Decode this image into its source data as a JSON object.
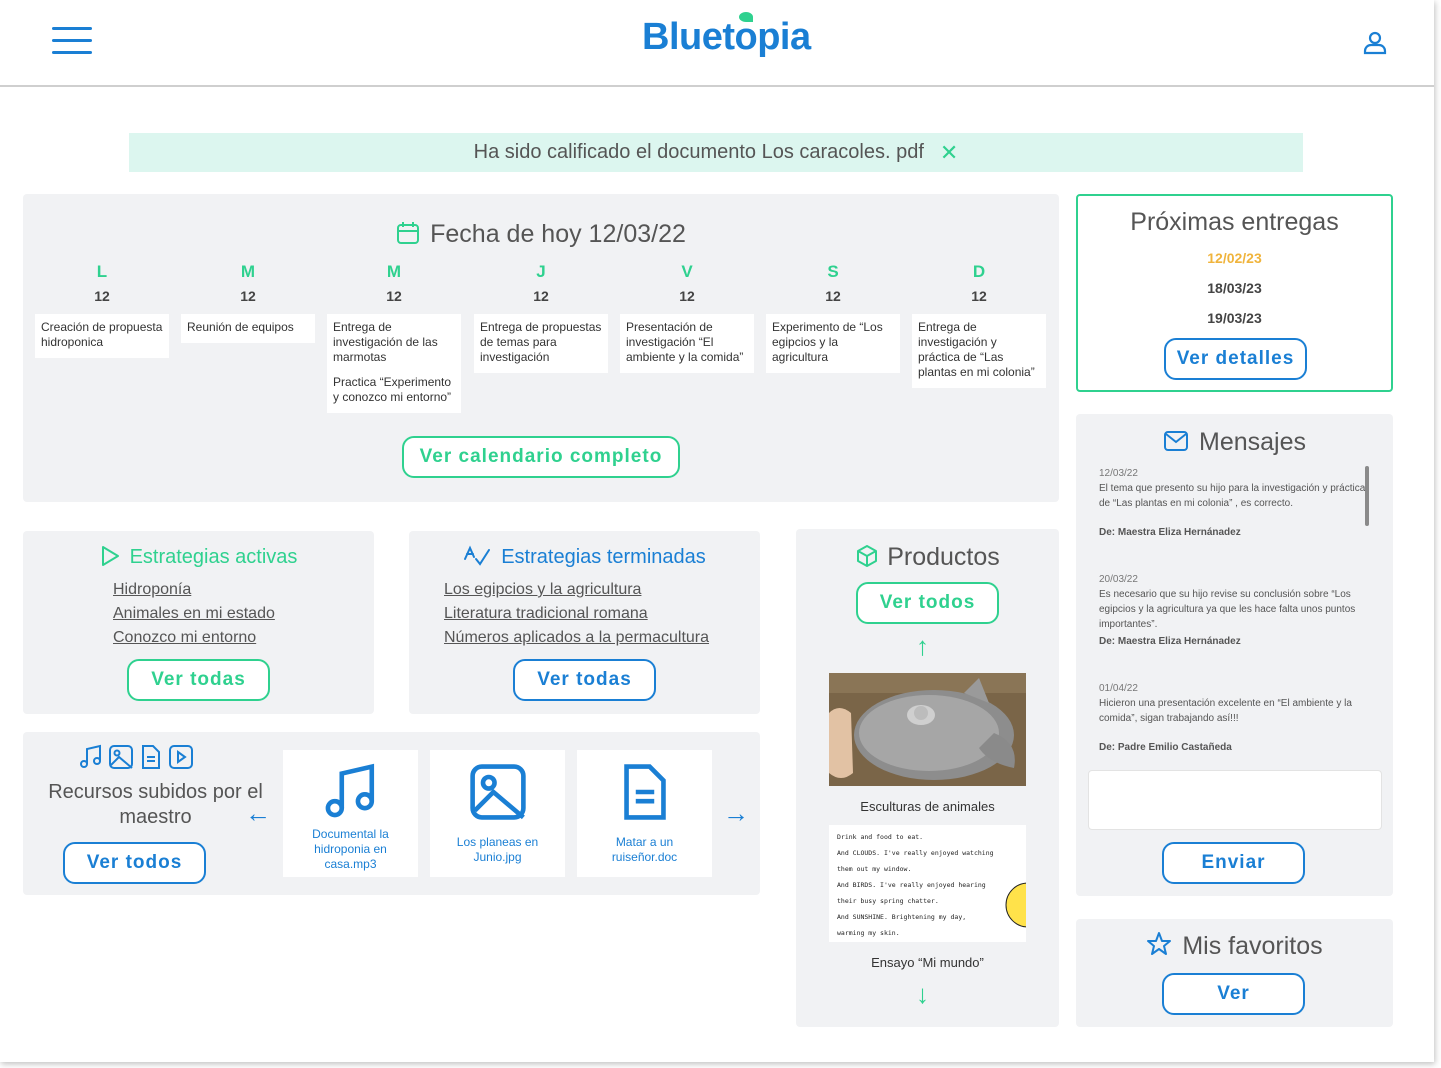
{
  "header": {
    "logo_text": "Bluetopia",
    "logo_prefix": "Bluet",
    "logo_o": "o",
    "logo_suffix": "pia"
  },
  "notice": {
    "text": "Ha sido calificado el documento Los caracoles. pdf",
    "close": "✕"
  },
  "calendar": {
    "title": "Fecha de hoy 12/03/22",
    "days": [
      {
        "letter": "L",
        "num": "12",
        "items": [
          "Creación de propuesta hidroponica"
        ]
      },
      {
        "letter": "M",
        "num": "12",
        "items": [
          "Reunión de equipos"
        ]
      },
      {
        "letter": "M",
        "num": "12",
        "items": [
          "Entrega de investigación de las marmotas",
          "Practica “Experimento y conozco mi entorno”"
        ]
      },
      {
        "letter": "J",
        "num": "12",
        "items": [
          "Entrega de propuestas de temas para investigación"
        ]
      },
      {
        "letter": "V",
        "num": "12",
        "items": [
          "Presentación de investigación “El ambiente y la comida”"
        ]
      },
      {
        "letter": "S",
        "num": "12",
        "items": [
          "Experimento de “Los egipcios y la agricultura"
        ]
      },
      {
        "letter": "D",
        "num": "12",
        "items": [
          "Entrega de investigación y práctica de “Las plantas en mi colonia”"
        ]
      }
    ],
    "button": "Ver calendario completo"
  },
  "active": {
    "title": "Estrategias activas",
    "items": [
      "Hidroponía",
      "Animales en mi estado",
      "Conozco mi entorno"
    ],
    "button": "Ver todas"
  },
  "finished": {
    "title": "Estrategias terminadas",
    "items": [
      "Los egipcios y la agricultura",
      "Literatura tradicional romana",
      "Números aplicados a la permacultura"
    ],
    "button": "Ver todas"
  },
  "resources": {
    "title": "Recursos subidos por el maestro",
    "button": "Ver todos",
    "prev": "←",
    "next": "→",
    "files": [
      "Documental la hidroponia en casa.mp3",
      "Los planeas en Junio.jpg",
      "Matar a un ruiseñor.doc"
    ]
  },
  "products": {
    "title": "Productos",
    "button": "Ver todos",
    "up": "↑",
    "down": "↓",
    "items": [
      {
        "caption": "Esculturas de animales"
      },
      {
        "caption": "Ensayo “Mi mundo”"
      }
    ],
    "essay_lines": [
      "Drink and food to eat.",
      "And CLOUDS. I've really enjoyed watching",
      "them out my window.",
      "And BIRDS. I've really enjoyed hearing",
      "their busy spring chatter.",
      "And SUNSHINE. Brightening my day,",
      "warming my skin."
    ]
  },
  "deliveries": {
    "title": "Próximas entregas",
    "dates": [
      "12/02/23",
      "18/03/23",
      "19/03/23"
    ],
    "highlight_color": "#f0b43c",
    "button": "Ver detalles"
  },
  "messages": {
    "title": "Mensajes",
    "items": [
      {
        "date": "12/03/22",
        "text": "El tema que presento su hijo para la investigación y práctica de “Las plantas en mi colonia” , es correcto.",
        "author": "De: Maestra Eliza Hernánadez"
      },
      {
        "date": "20/03/22",
        "text": "Es necesario que su hijo revise su conclusión sobre “Los egipcios y la agricultura ya que les hace falta unos puntos importantes”.",
        "author": "De: Maestra Eliza Hernánadez"
      },
      {
        "date": "01/04/22",
        "text": "Hicieron una presentación excelente en “El ambiente y la comida”, sigan trabajando así!!!",
        "author": "De: Padre Emilio Castañeda"
      }
    ],
    "button": "Enviar"
  },
  "favorites": {
    "title": "Mis favoritos",
    "button": "Ver"
  },
  "colors": {
    "accent_green": "#2fd18f",
    "accent_blue": "#1a7fd4",
    "panel_bg": "#f1f2f4"
  }
}
